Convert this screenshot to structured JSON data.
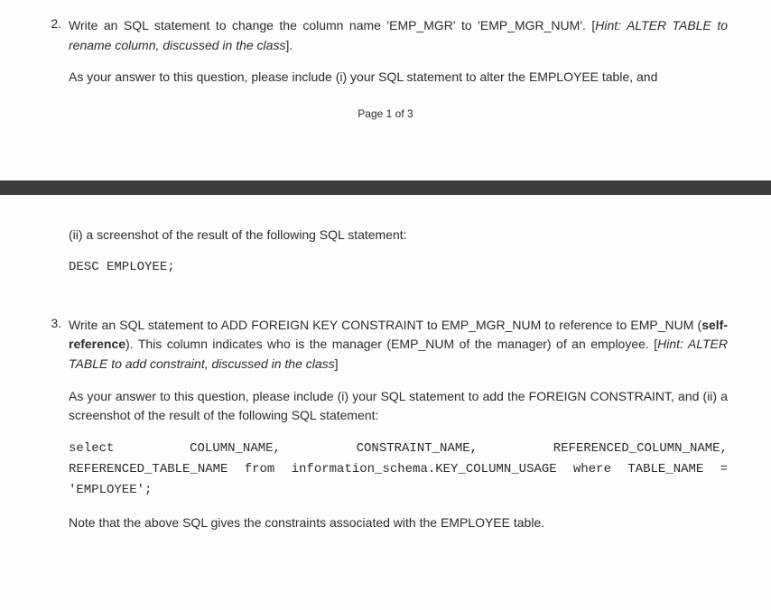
{
  "page1": {
    "q2": {
      "number": "2.",
      "text_before_hint": "Write an SQL statement to change the column name 'EMP_MGR' to 'EMP_MGR_NUM'. [",
      "hint": "Hint: ALTER TABLE to rename column, discussed in the class",
      "text_after_hint": "].",
      "answer_instruction": "As your answer to this question, please include (i) your SQL statement to alter the EMPLOYEE table, and"
    },
    "page_indicator": "Page 1 of 3"
  },
  "page2": {
    "continuation": {
      "part_ii": "(ii) a screenshot of the result of the following SQL statement:",
      "code": "DESC EMPLOYEE;"
    },
    "q3": {
      "number": "3.",
      "line1_a": "Write an SQL statement to ADD FOREIGN KEY CONSTRAINT to EMP_MGR_NUM to reference to EMP_NUM (",
      "line1_bold": "self-reference",
      "line1_b": "). This column indicates who is the manager (EMP_NUM of the manager) of an employee. [",
      "hint": "Hint: ALTER TABLE to add constraint, discussed in the class",
      "line1_c": "]",
      "answer_instruction": "As your answer to this question, please include (i) your SQL statement to add the FOREIGN CONSTRAINT, and (ii) a screenshot of the result of the following SQL statement:",
      "sql_select": "select",
      "sql_col1": "COLUMN_NAME,",
      "sql_col2": "CONSTRAINT_NAME,",
      "sql_col3": "REFERENCED_COLUMN_NAME,",
      "sql_line2": "REFERENCED_TABLE_NAME from information_schema.KEY_COLUMN_USAGE where TABLE_NAME = 'EMPLOYEE';",
      "note": "Note that the above SQL gives the constraints associated with the EMPLOYEE table."
    }
  }
}
